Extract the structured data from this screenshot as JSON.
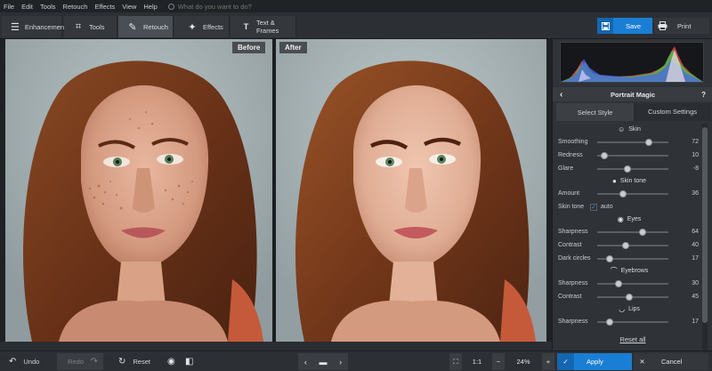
{
  "menu": [
    "File",
    "Edit",
    "Tools",
    "Retouch",
    "Effects",
    "View",
    "Help"
  ],
  "search": {
    "placeholder": "What do you want to do?"
  },
  "toolbar": {
    "tabs": [
      {
        "label": "Enhancement",
        "icon": "sliders-icon"
      },
      {
        "label": "Tools",
        "icon": "crop-icon"
      },
      {
        "label": "Retouch",
        "icon": "brush-icon"
      },
      {
        "label": "Effects",
        "icon": "magic-wand-icon"
      },
      {
        "label": "Text & Frames",
        "icon": "text-icon"
      }
    ],
    "active_tab": "Retouch",
    "save_label": "Save",
    "print_label": "Print"
  },
  "canvas": {
    "before_label": "Before",
    "after_label": "After"
  },
  "panel": {
    "title": "Portrait Magic",
    "help": "?",
    "subtabs": [
      "Select Style",
      "Custom Settings"
    ],
    "active_subtab": "Custom Settings",
    "sections": [
      {
        "title": "Skin",
        "icon": "face-icon",
        "controls": [
          {
            "label": "Smoothing",
            "value": 72,
            "min": 0,
            "max": 100
          },
          {
            "label": "Redness",
            "value": 10,
            "min": 0,
            "max": 100
          },
          {
            "label": "Glare",
            "value": -8,
            "min": -50,
            "max": 50
          }
        ]
      },
      {
        "title": "Skin tone",
        "icon": "drop-icon",
        "controls": [
          {
            "label": "Amount",
            "value": 36,
            "min": 0,
            "max": 100
          }
        ],
        "checkbox": {
          "label": "Skin tone",
          "option": "auto",
          "checked": true
        }
      },
      {
        "title": "Eyes",
        "icon": "eye-icon",
        "controls": [
          {
            "label": "Sharpness",
            "value": 64,
            "min": 0,
            "max": 100
          },
          {
            "label": "Contrast",
            "value": 40,
            "min": 0,
            "max": 100
          },
          {
            "label": "Dark circles",
            "value": 17,
            "min": 0,
            "max": 100
          }
        ]
      },
      {
        "title": "Eyebrows",
        "icon": "eyebrow-icon",
        "controls": [
          {
            "label": "Sharpness",
            "value": 30,
            "min": 0,
            "max": 100
          },
          {
            "label": "Contrast",
            "value": 45,
            "min": 0,
            "max": 100
          }
        ]
      },
      {
        "title": "Lips",
        "icon": "lips-icon",
        "controls": [
          {
            "label": "Sharpness",
            "value": 17,
            "min": 0,
            "max": 100
          }
        ]
      }
    ],
    "reset_all": "Reset all"
  },
  "bottombar": {
    "undo": "Undo",
    "redo": "Redo",
    "reset": "Reset",
    "zoom_1to1": "1:1",
    "zoom": "24%",
    "apply": "Apply",
    "cancel": "Cancel"
  },
  "colors": {
    "accent": "#1a7fd4",
    "panel": "#2f3337",
    "background": "#2a2d31"
  }
}
